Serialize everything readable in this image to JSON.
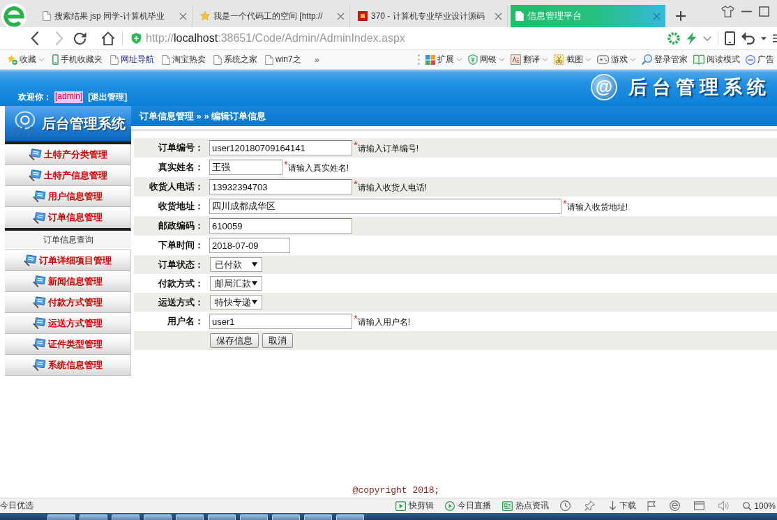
{
  "browser": {
    "tabs": [
      {
        "title": "搜索结果 jsp 同学-计算机毕业",
        "selected": false
      },
      {
        "title": "我是一个代码工的空间 [http://",
        "selected": false
      },
      {
        "title": "370 - 计算机专业毕业设计源码",
        "selected": false
      },
      {
        "title": "信息管理平台",
        "selected": true
      }
    ],
    "address": {
      "scheme": "http://",
      "host": "localhost",
      "path": ":38651/Code/Admin/AdminIndex.aspx"
    },
    "bookmarks": [
      {
        "label": "收藏",
        "dropdown": true,
        "highlighted": false
      },
      {
        "label": "手机收藏夹",
        "dropdown": false,
        "highlighted": false
      },
      {
        "label": "网址导航",
        "dropdown": false,
        "highlighted": true
      },
      {
        "label": "淘宝热卖",
        "dropdown": false,
        "highlighted": false
      },
      {
        "label": "系统之家",
        "dropdown": false,
        "highlighted": false
      },
      {
        "label": "win7之",
        "dropdown": false,
        "highlighted": false
      }
    ],
    "more_bookmarks": "»",
    "tools": [
      {
        "label": "扩展",
        "dropdown": true
      },
      {
        "label": "网银",
        "dropdown": true
      },
      {
        "label": "翻译",
        "dropdown": true
      },
      {
        "label": "截图",
        "dropdown": true
      },
      {
        "label": "游戏",
        "dropdown": true
      },
      {
        "label": "登录管家",
        "dropdown": false
      },
      {
        "label": "阅读模式",
        "dropdown": false
      },
      {
        "label": "广告",
        "dropdown": false
      }
    ]
  },
  "header": {
    "welcome": "欢迎你：",
    "user": "[admin]",
    "logout": "[退出管理]",
    "logo_mark": "@",
    "title": "后台管理系统"
  },
  "sidebar": {
    "title": "后台管理系统",
    "items": [
      {
        "label": "土特产分类管理",
        "expanded": false
      },
      {
        "label": "土特产信息管理",
        "expanded": false
      },
      {
        "label": "用户信息管理",
        "expanded": false
      },
      {
        "label": "订单信息管理",
        "expanded": true,
        "children": [
          {
            "label": "订单信息查询"
          }
        ]
      },
      {
        "label": "订单详细项目管理",
        "expanded": false
      },
      {
        "label": "新闻信息管理",
        "expanded": false
      },
      {
        "label": "付款方式管理",
        "expanded": false
      },
      {
        "label": "运送方式管理",
        "expanded": false
      },
      {
        "label": "证件类型管理",
        "expanded": false
      },
      {
        "label": "系统信息管理",
        "expanded": false
      }
    ]
  },
  "breadcrumb": "订单信息管理 » » 编辑订单信息",
  "form": {
    "required_mark": "*",
    "fields": [
      {
        "label": "订单编号：",
        "kind": "text",
        "value": "user120180709164141",
        "required": true,
        "hint": "请输入订单编号!"
      },
      {
        "label": "真实姓名：",
        "kind": "short",
        "value": "王强",
        "required": true,
        "hint": "请输入真实姓名!"
      },
      {
        "label": "收货人电话：",
        "kind": "text",
        "value": "13932394703",
        "required": true,
        "hint": "请输入收货人电话!"
      },
      {
        "label": "收货地址：",
        "kind": "long",
        "value": "四川成都成华区",
        "required": true,
        "hint": "请输入收货地址!"
      },
      {
        "label": "邮政编码：",
        "kind": "text",
        "value": "610059",
        "required": false
      },
      {
        "label": "下单时间：",
        "kind": "date",
        "value": "2018-07-09",
        "required": false
      },
      {
        "label": "订单状态：",
        "kind": "select",
        "value": "已付款",
        "required": false
      },
      {
        "label": "付款方式：",
        "kind": "select",
        "value": "邮局汇款",
        "required": false
      },
      {
        "label": "运送方式：",
        "kind": "select",
        "value": "特快专递",
        "required": false
      },
      {
        "label": "用户名：",
        "kind": "text",
        "value": "user1",
        "required": true,
        "hint": "请输入用户名!"
      }
    ],
    "buttons": [
      {
        "label": "保存信息"
      },
      {
        "label": "取消"
      }
    ]
  },
  "footer": "@copyright 2018;",
  "status_bar": {
    "left": "今日优选",
    "items": [
      {
        "label": "快剪辑"
      },
      {
        "label": "今日直播"
      },
      {
        "label": "热点资讯"
      },
      {
        "label": "下载"
      },
      {
        "label": "100%"
      }
    ]
  }
}
